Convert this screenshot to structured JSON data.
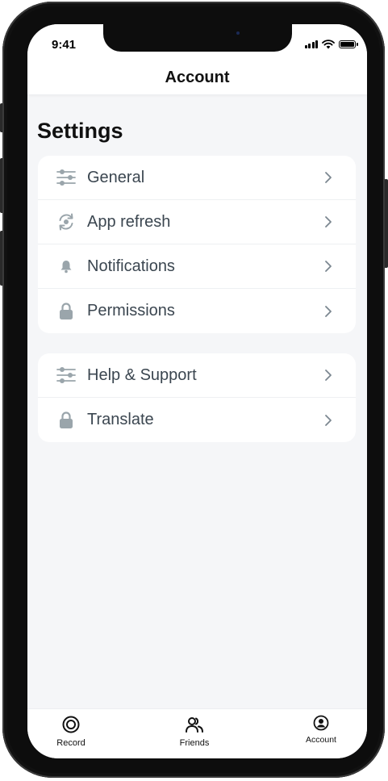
{
  "status_bar": {
    "time": "9:41",
    "icons": [
      "signal-icon",
      "wifi-icon",
      "battery-icon"
    ]
  },
  "header": {
    "title": "Account"
  },
  "settings": {
    "title": "Settings",
    "groups": [
      {
        "items": [
          {
            "label": "General",
            "icon": "sliders-icon"
          },
          {
            "label": "App refresh",
            "icon": "refresh-icon"
          },
          {
            "label": "Notifications",
            "icon": "bell-icon"
          },
          {
            "label": "Permissions",
            "icon": "lock-icon"
          }
        ]
      },
      {
        "items": [
          {
            "label": "Help & Support",
            "icon": "sliders-icon"
          },
          {
            "label": "Translate",
            "icon": "lock-icon"
          }
        ]
      }
    ]
  },
  "tabbar": {
    "tabs": [
      {
        "label": "Record",
        "icon": "record-icon"
      },
      {
        "label": "Friends",
        "icon": "friends-icon"
      },
      {
        "label": "Account",
        "icon": "account-icon",
        "active": true
      }
    ]
  },
  "colors": {
    "background": "#f5f6f8",
    "card": "#ffffff",
    "icon_gray": "#9aa5ab",
    "label_text": "#3b4650",
    "frame": "#0d0d0d"
  }
}
